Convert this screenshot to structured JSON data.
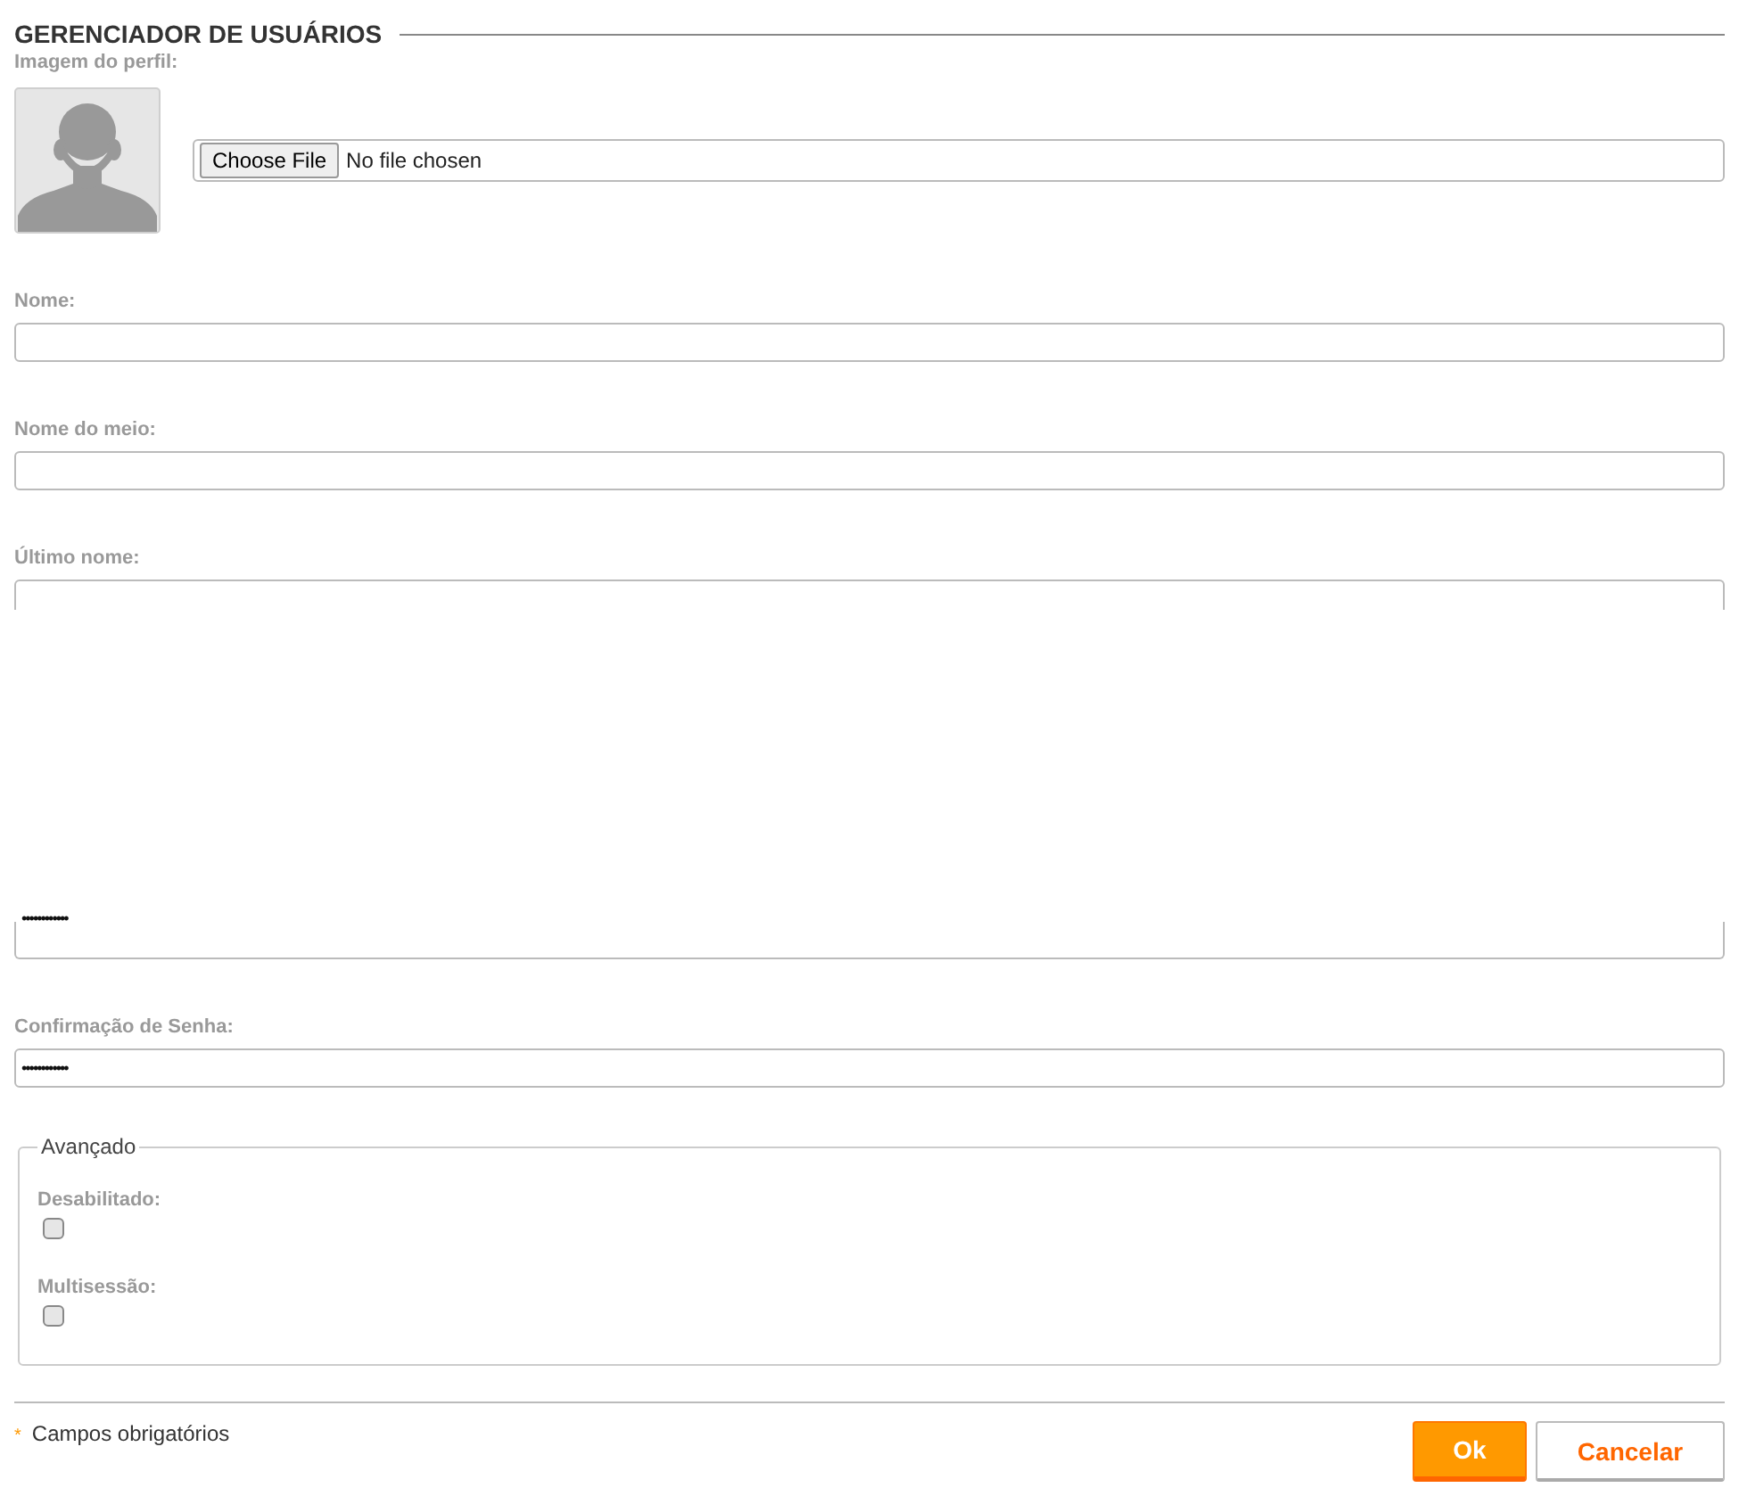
{
  "title": "GERENCIADOR DE USUÁRIOS",
  "profile_image": {
    "label": "Imagem do perfil:",
    "file_button": "Choose File",
    "file_status": "No file chosen"
  },
  "fields": [
    {
      "kind": "full",
      "label": "Nome:"
    },
    {
      "kind": "full",
      "label": "Nome do meio:"
    },
    {
      "kind": "cut_top",
      "label": "Último nome:"
    },
    {
      "kind": "cut_bottom",
      "value": "••••••••••••"
    },
    {
      "kind": "full",
      "label": "Confirmação de Senha:",
      "value": "••••••••••••"
    }
  ],
  "advanced": {
    "legend": "Avançado",
    "options": [
      {
        "label": "Desabilitado:",
        "checked": false
      },
      {
        "label": "Multisessão:",
        "checked": false
      }
    ]
  },
  "required_note": {
    "mark": "*",
    "text": "Campos obrigatórios"
  },
  "buttons": [
    {
      "label": "Ok",
      "kind": "primary"
    },
    {
      "label": "Cancelar",
      "kind": "secondary"
    }
  ]
}
